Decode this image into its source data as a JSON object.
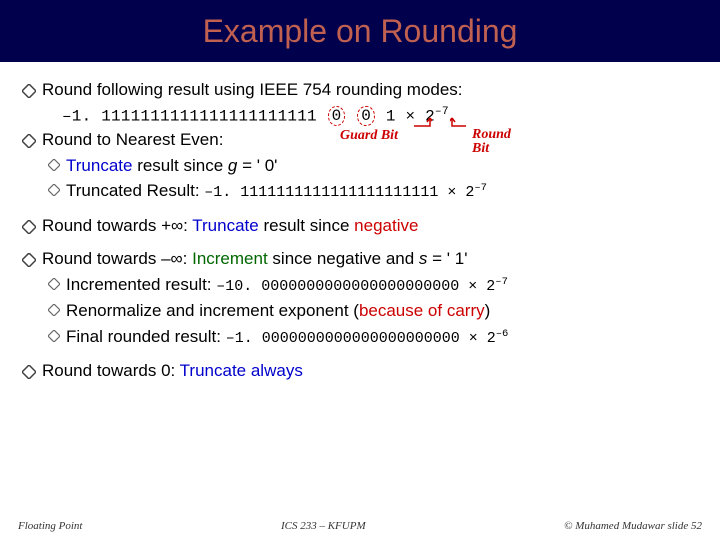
{
  "title": "Example on Rounding",
  "b1": "Round following result using IEEE 754 rounding modes:",
  "numline": {
    "prefix": "–1. 1111111111111111111111 ",
    "g": "0",
    "r": "0",
    "suffix": " 1 × 2",
    "exp": "–7"
  },
  "annot": {
    "guard": "Guard Bit",
    "round": "Round\nBit"
  },
  "b2": "Round to Nearest Even:",
  "b2s1_a": "Truncate",
  "b2s1_b": " result since ",
  "b2s1_c": "g",
  "b2s1_d": " = ' 0'",
  "b2s2_a": "Truncated Result: ",
  "b2s2_b": "–1. 1111111111111111111111 × 2",
  "b2s2_exp": "–7",
  "b3_a": "Round towards +∞: ",
  "b3_b": "Truncate",
  "b3_c": " result since ",
  "b3_d": "negative",
  "b4_a": "Round towards –∞: ",
  "b4_b": "Increment",
  "b4_c": " since negative and ",
  "b4_d": "s",
  "b4_e": " = ' 1'",
  "b4s1_a": "Incremented result: ",
  "b4s1_b": "–10. 0000000000000000000000 × 2",
  "b4s1_exp": "–7",
  "b4s2_a": "Renormalize and increment exponent (",
  "b4s2_b": "because of carry",
  "b4s2_c": ")",
  "b4s3_a": "Final rounded result: ",
  "b4s3_b": "–1. 0000000000000000000000 × 2",
  "b4s3_exp": "–6",
  "b5_a": "Round towards 0:   ",
  "b5_b": "Truncate always",
  "footer": {
    "left": "Floating Point",
    "center": "ICS 233 – KFUPM",
    "right": "© Muhamed Mudawar   slide 52"
  }
}
